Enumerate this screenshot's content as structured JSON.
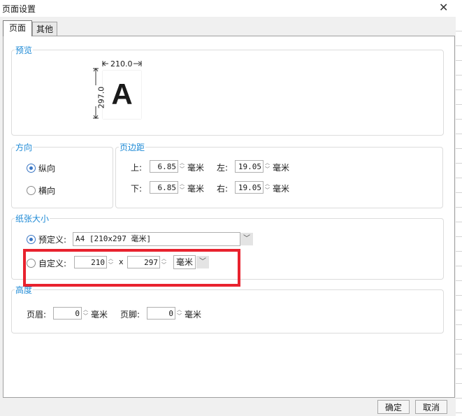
{
  "window": {
    "title": "页面设置",
    "close_glyph": "✕"
  },
  "tabs": [
    {
      "label": "页面"
    },
    {
      "label": "其他"
    }
  ],
  "preview": {
    "label": "预览",
    "width": "210.0",
    "height": "297.0",
    "letter": "A"
  },
  "orientation": {
    "label": "方向",
    "portrait": "纵向",
    "landscape": "横向",
    "selected": "portrait"
  },
  "margins": {
    "label": "页边距",
    "top_label": "上:",
    "top_value": "6.85",
    "left_label": "左:",
    "left_value": "19.05",
    "bottom_label": "下:",
    "bottom_value": "6.85",
    "right_label": "右:",
    "right_value": "19.05",
    "unit": "毫米"
  },
  "paper": {
    "label": "纸张大小",
    "preset_label": "预定义:",
    "preset_value": "A4 [210x297 毫米]",
    "custom_label": "自定义:",
    "custom_width": "210",
    "times": "x",
    "custom_height": "297",
    "custom_unit": "毫米",
    "selected": "preset"
  },
  "height": {
    "label": "高度",
    "header_label": "页眉:",
    "header_value": "0",
    "footer_label": "页脚:",
    "footer_value": "0",
    "unit": "毫米"
  },
  "footer": {
    "ok": "确定",
    "cancel": "取消"
  },
  "colors": {
    "accent": "#1e8ad6",
    "highlight": "#e8222e",
    "radio": "#3a76c4"
  }
}
